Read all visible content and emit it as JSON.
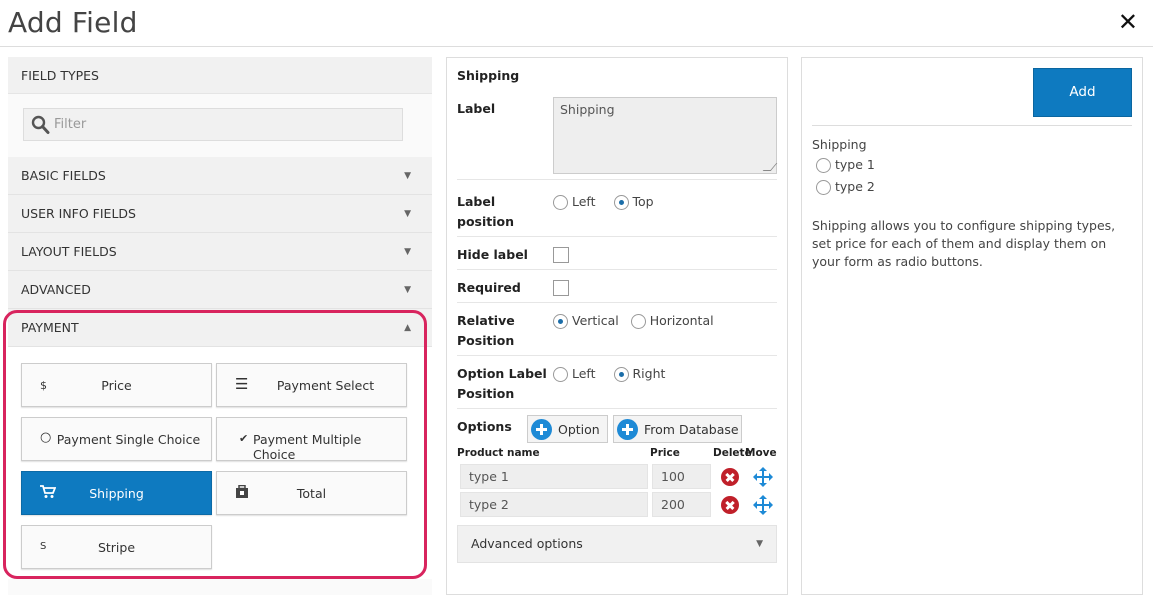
{
  "dialog": {
    "title": "Add Field",
    "close": "✕"
  },
  "left": {
    "field_types": "FIELD TYPES",
    "filter_placeholder": "Filter",
    "sections": [
      "BASIC FIELDS",
      "USER INFO FIELDS",
      "LAYOUT FIELDS",
      "ADVANCED",
      "PAYMENT"
    ],
    "collapsed_arrow": "▼",
    "expanded_arrow": "▲",
    "payment_items": [
      {
        "label": "Price",
        "icon": "$",
        "icon_name": "dollar-icon"
      },
      {
        "label": "Payment Select",
        "icon": "☰",
        "icon_name": "list-icon"
      },
      {
        "label": "Payment Single Choice",
        "icon": "○",
        "icon_name": "radio-icon"
      },
      {
        "label": "Payment Multiple Choice",
        "icon": "✔",
        "icon_name": "checkmark-icon"
      },
      {
        "label": "Shipping",
        "icon": "🛒",
        "icon_name": "cart-icon",
        "active": true
      },
      {
        "label": "Total",
        "icon": "▣",
        "icon_name": "calculator-icon"
      },
      {
        "label": "Stripe",
        "icon": "S",
        "icon_name": "stripe-icon"
      }
    ]
  },
  "settings": {
    "heading": "Shipping",
    "label": {
      "label": "Label",
      "value": "Shipping"
    },
    "label_position": {
      "label_line1": "Label",
      "label_line2": "position",
      "options": [
        "Left",
        "Top"
      ],
      "selected": "Top"
    },
    "hide_label": {
      "label": "Hide label",
      "checked": false
    },
    "required": {
      "label": "Required",
      "checked": false
    },
    "relative_position": {
      "label_line1": "Relative",
      "label_line2": "Position",
      "options": [
        "Vertical",
        "Horizontal"
      ],
      "selected": "Vertical"
    },
    "option_label_position": {
      "label_line1": "Option Label",
      "label_line2": "Position",
      "options": [
        "Left",
        "Right"
      ],
      "selected": "Right"
    },
    "options": {
      "label": "Options",
      "add_option_button": "Option",
      "from_database_button": "From Database",
      "columns": {
        "product": "Product name",
        "price": "Price",
        "delete": "Delete",
        "move": "Move"
      },
      "rows": [
        {
          "name": "type 1",
          "price": "100"
        },
        {
          "name": "type 2",
          "price": "200"
        }
      ]
    },
    "advanced_options": "Advanced options"
  },
  "preview": {
    "add_button": "Add",
    "field_label": "Shipping",
    "choices": [
      "type 1",
      "type 2"
    ],
    "description": "Shipping allows you to configure shipping types, set price for each of them and display them on your form as radio buttons."
  },
  "colors": {
    "accent": "#0e7ac0",
    "highlight": "#d8245e",
    "delete": "#c0202a",
    "move": "#1e8ad6"
  }
}
